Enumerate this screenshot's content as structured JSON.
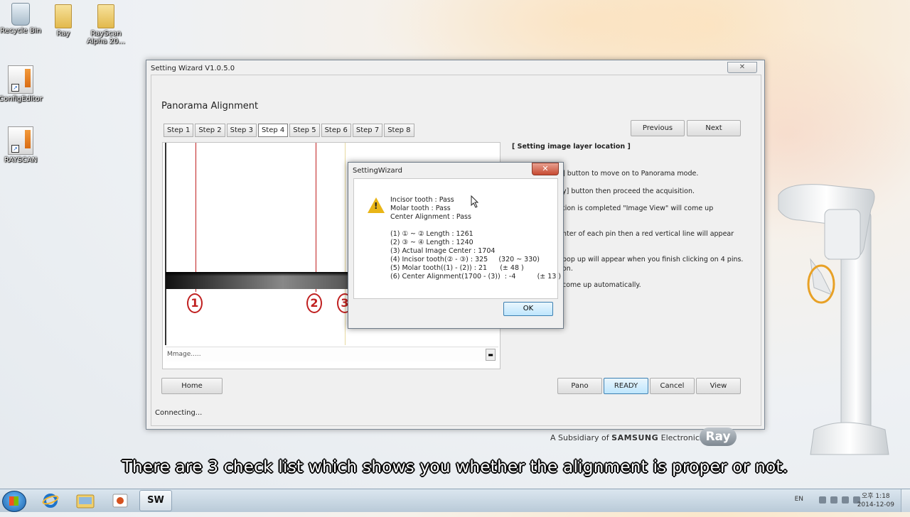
{
  "desktop": {
    "icons": [
      {
        "label": "Recycle Bin"
      },
      {
        "label": "Ray"
      },
      {
        "label": "RayScan Alpha 20..."
      },
      {
        "label": "ConfigEditor"
      },
      {
        "label": "RAYSCAN"
      }
    ]
  },
  "window": {
    "title": "Setting Wizard V1.0.5.0",
    "close_glyph": "✕",
    "page_title": "Panorama Alignment",
    "steps": [
      "Step 1",
      "Step 2",
      "Step 3",
      "Step 4",
      "Step 5",
      "Step 6",
      "Step 7",
      "Step 8"
    ],
    "active_step": "Step 4",
    "buttons": {
      "previous": "Previous",
      "next": "Next",
      "home": "Home",
      "pano": "Pano",
      "ready": "READY",
      "cancel": "Cancel",
      "view": "View"
    },
    "image_status": "Mmage.....",
    "pins": [
      "1",
      "2",
      "3"
    ],
    "instructions": {
      "heading": "[ Setting image layer location ]",
      "lines": [
        "] button to move on to Panorama mode.",
        "y] button then proceed the acquisition.",
        "tion is completed \"Image View\" will come up",
        "nter of each pin then a red vertical line will appear",
        "pop up will appear when you finish clicking on 4 pins.",
        "on.",
        "come up automatically."
      ]
    },
    "status_text": "Connecting..."
  },
  "dialog": {
    "title": "SettingWizard",
    "close_glyph": "✕",
    "results": [
      "Incisor tooth : Pass",
      "Molar tooth : Pass",
      "Center Alignment : Pass"
    ],
    "details": [
      "(1) ① ~ ② Length : 1261",
      "(2) ③ ~ ④ Length : 1240",
      "(3) Actual Image Center : 1704",
      "(4) Incisor tooth(② - ③) : 325     (320 ~ 330)",
      "(5) Molar tooth((1) - (2)) : 21      (± 48 )",
      "(6) Center Alignment(1700 - (3))  : -4          (± 13 )"
    ],
    "ok_label": "OK"
  },
  "branding": {
    "prefix": "A Subsidiary of",
    "brand": "SAMSUNG",
    "suffix": "Electronics",
    "logo": "Ray"
  },
  "caption": "There are 3 check list which shows you whether the alignment is proper or not.",
  "taskbar": {
    "sw_label": "SW",
    "lang": "EN",
    "time": "오후 1:18",
    "date": "2014-12-09"
  }
}
